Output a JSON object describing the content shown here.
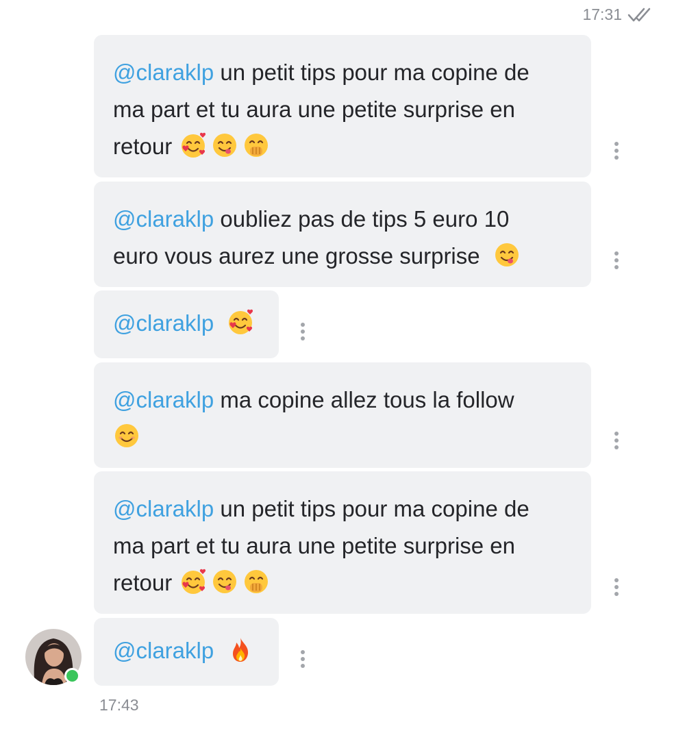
{
  "header": {
    "time": "17:31",
    "read_receipt_icon": "double-check-icon"
  },
  "messages": [
    {
      "mention": "@claraklp",
      "line1": " un petit tips pour ma copine de",
      "line2": "ma part et tu aura une petite surprise en",
      "line3": "retour",
      "emojis": [
        "smiling-face-with-hearts-emoji",
        "face-savoring-food-emoji",
        "face-with-hand-over-mouth-emoji"
      ]
    },
    {
      "mention": "@claraklp",
      "line1": " oubliez pas de tips 5 euro 10",
      "line2": "euro vous aurez une grosse surprise",
      "emojis": [
        "face-savoring-food-emoji"
      ]
    },
    {
      "mention": "@claraklp",
      "emojis": [
        "smiling-face-with-hearts-emoji"
      ]
    },
    {
      "mention": "@claraklp",
      "line1": " ma copine allez tous la follow",
      "emojis": [
        "smiling-face-emoji"
      ]
    },
    {
      "mention": "@claraklp",
      "line1": " un petit tips pour ma copine de",
      "line2": "ma part et tu aura une petite surprise en",
      "line3": "retour",
      "emojis": [
        "smiling-face-with-hearts-emoji",
        "face-savoring-food-emoji",
        "face-with-hand-over-mouth-emoji"
      ]
    },
    {
      "mention": "@claraklp",
      "emojis": [
        "fire-emoji"
      ]
    }
  ],
  "footer": {
    "time": "17:43"
  },
  "colors": {
    "bubble": "#f0f1f3",
    "mention": "#3fa1e0",
    "text": "#242529",
    "meta": "#8a8d93",
    "online": "#3ac55b"
  }
}
